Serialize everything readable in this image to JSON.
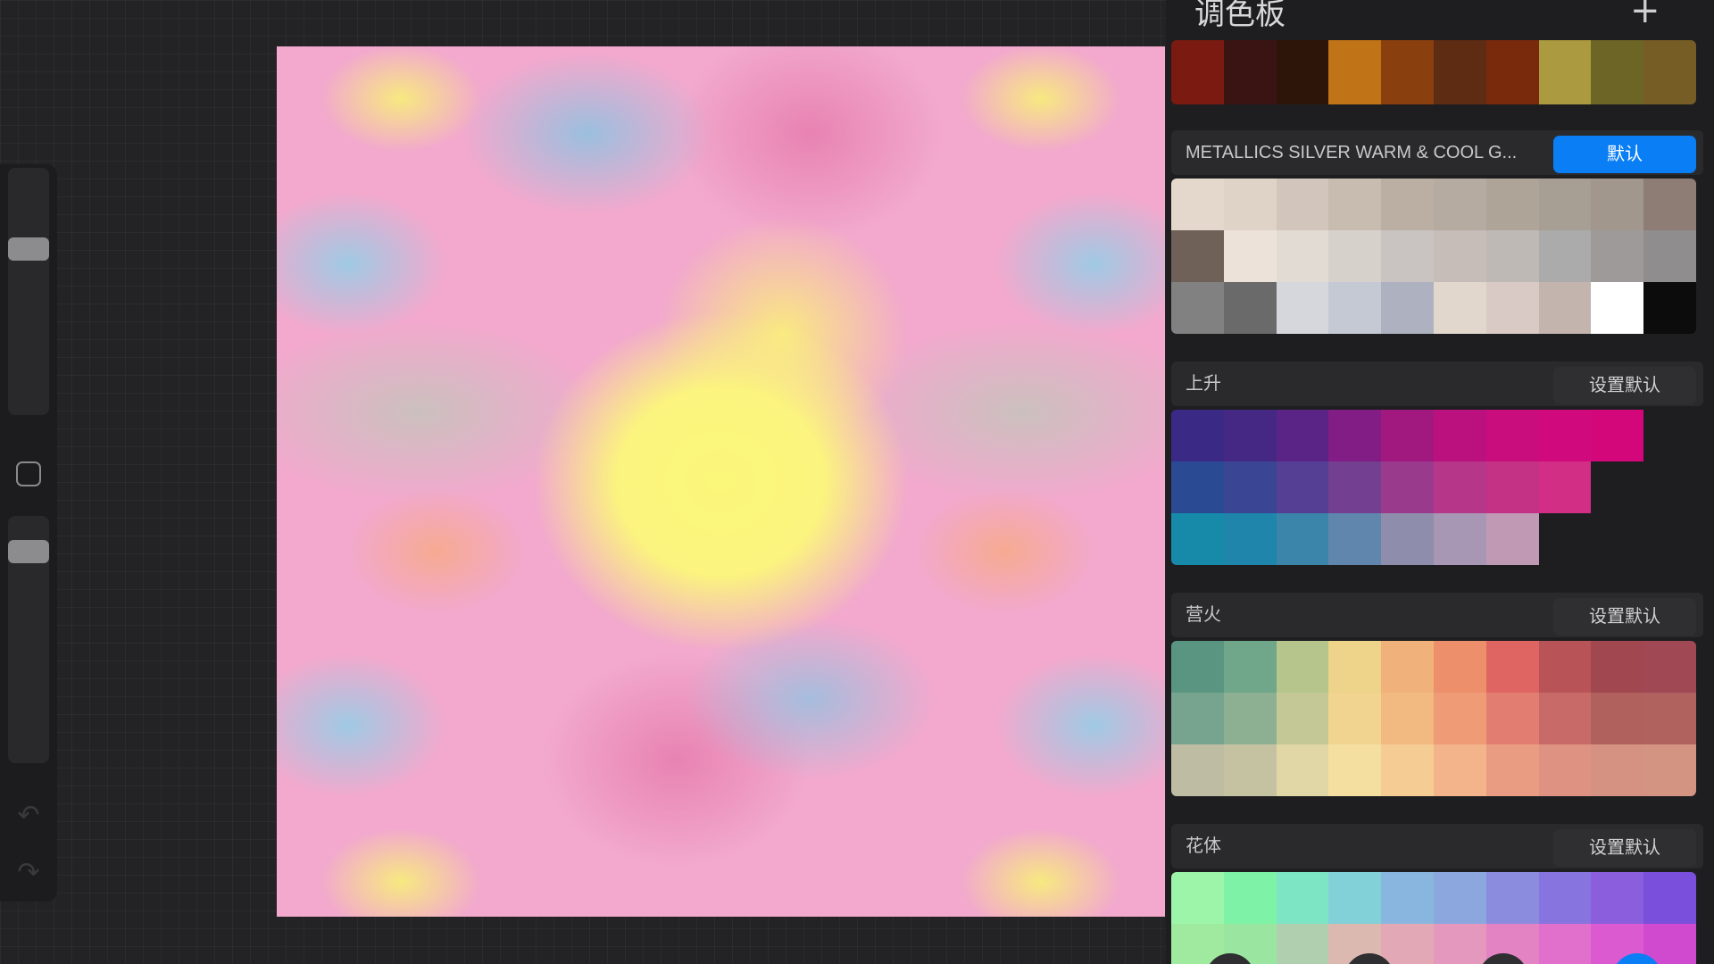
{
  "panel": {
    "title": "调色板",
    "add_label": "+",
    "partial_top_row": [
      "#7a1a10",
      "#3a1412",
      "#2e1509",
      "#c07417",
      "#8a3f0e",
      "#5e2c12",
      "#7a2a0c",
      "#ab9a3f",
      "#6d6526",
      "#765d26"
    ],
    "palettes": [
      {
        "name": "METALLICS SILVER WARM & COOL G...",
        "button": "默认",
        "is_default": true,
        "swatches": [
          "#e4d8cc",
          "#dfd3c8",
          "#d2c6bc",
          "#c8bcb1",
          "#bbafa4",
          "#b5aba0",
          "#aea498",
          "#a89f94",
          "#a1978d",
          "#8e7d75",
          "#6f6158",
          "#ede2da",
          "#e2dbd4",
          "#d7d1cb",
          "#c9c4c1",
          "#c6bdb9",
          "#bfb9b5",
          "#ababab",
          "#9d9a99",
          "#8f8d8d",
          "#818181",
          "#6a6a6a",
          "#d5d7dd",
          "#c5c9d3",
          "#aeb2c0",
          "#e2d7cd",
          "#d9cac6",
          "#c3b5ad",
          "#ffffff",
          "#0c0c0c"
        ]
      },
      {
        "name": "上升",
        "button": "设置默认",
        "is_default": false,
        "swatches": [
          "#3a2a85",
          "#452883",
          "#5a2487",
          "#821d86",
          "#a1187f",
          "#bb117e",
          "#c90d7c",
          "#d00a7d",
          "#d4077a",
          "",
          "#2b4a94",
          "#3a4693",
          "#553f95",
          "#733f90",
          "#9a3a8c",
          "#b6368a",
          "#c33285",
          "#d32e85",
          "",
          "",
          "#168aa8",
          "#1f85aa",
          "#3a85a9",
          "#6186ad",
          "#8e8eac",
          "#a796b4",
          "#c099b5",
          "",
          "",
          ""
        ]
      },
      {
        "name": "营火",
        "button": "设置默认",
        "is_default": false,
        "swatches": [
          "#5a9582",
          "#70a68a",
          "#b5c58c",
          "#eed38a",
          "#f0b27a",
          "#ee8f6b",
          "#df6563",
          "#b85358",
          "#a1474f",
          "#a04955",
          "#77a48e",
          "#8db093",
          "#c3c896",
          "#f1d48f",
          "#f2b980",
          "#ef9b76",
          "#e27d71",
          "#c86a67",
          "#b0615e",
          "#b0625f",
          "#bebda3",
          "#c5c2a2",
          "#e1d7a6",
          "#f5dfa0",
          "#f6cc95",
          "#f3b38b",
          "#e99c82",
          "#de9282",
          "#d59282",
          "#d49482"
        ]
      },
      {
        "name": "花体",
        "button": "设置默认",
        "is_default": false,
        "swatches": [
          "#9cf5a8",
          "#7ef2a6",
          "#7de4c4",
          "#83d1d8",
          "#89b6de",
          "#8ca7de",
          "#8b8cde",
          "#8774de",
          "#8a5edd",
          "#7a4fdc",
          "#a0eaa0",
          "#9ae6a0",
          "#b0cfae",
          "#dbb9b1",
          "#e2a8b6",
          "#e498bd",
          "#e383c3",
          "#e070cb",
          "#dc5ad0",
          "#d04ad0"
        ]
      }
    ]
  }
}
